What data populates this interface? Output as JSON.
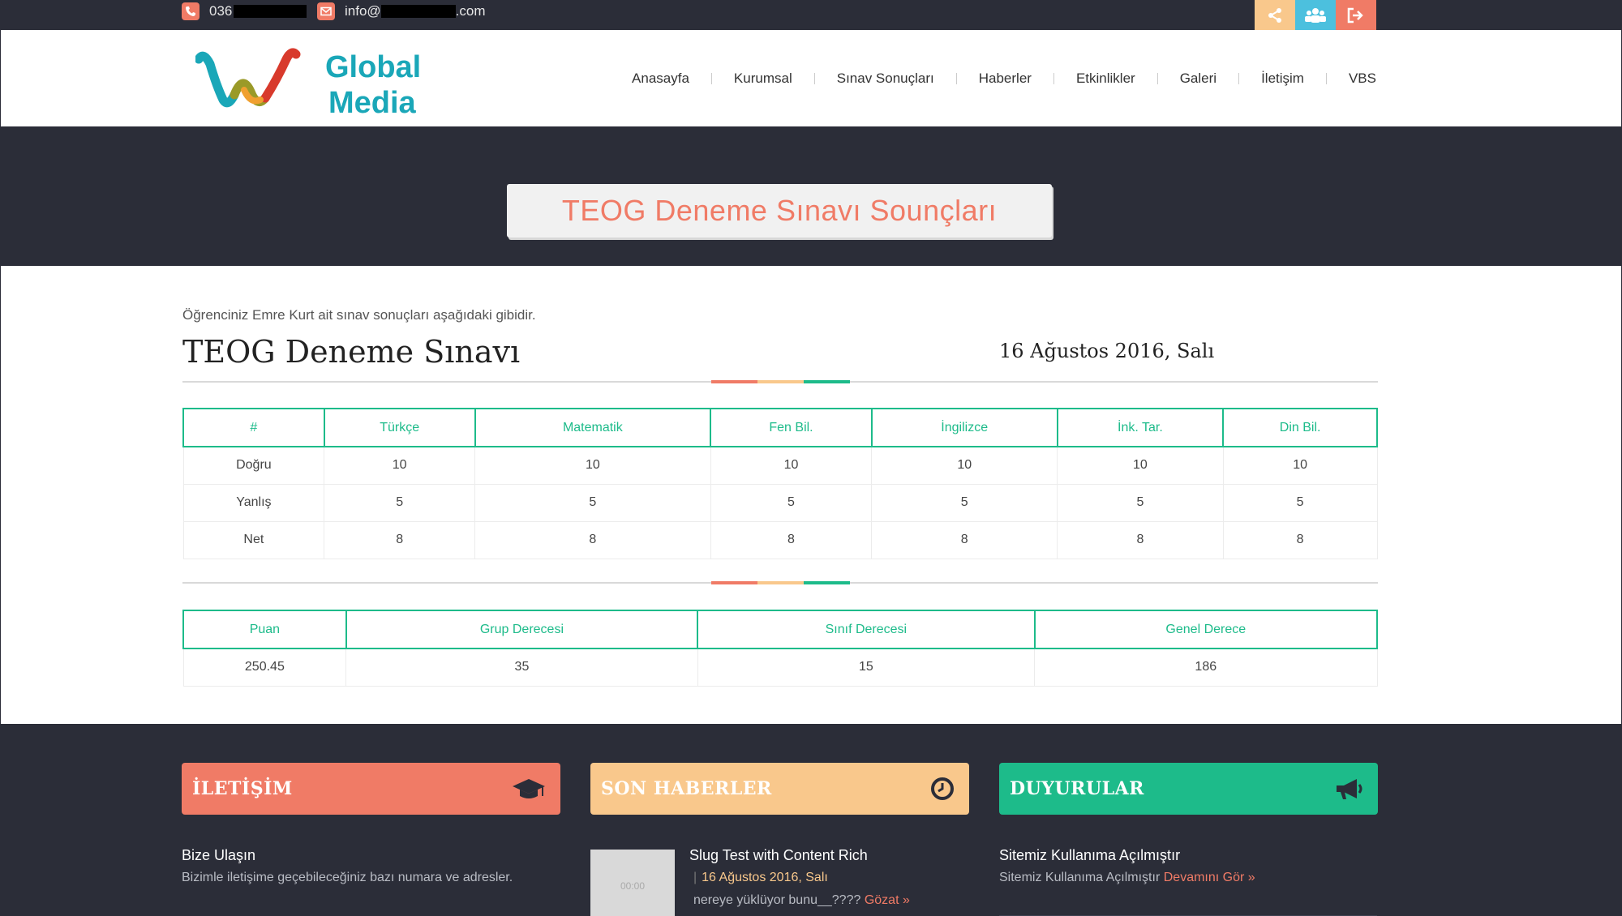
{
  "topbar": {
    "phone": "036",
    "email_prefix": "info@",
    "email_suffix": ".com",
    "colors": {
      "share": "#f9c88c",
      "users": "#4cc0de",
      "logout": "#f07b66"
    }
  },
  "header": {
    "logo_line1": "Global",
    "logo_line2": "Media",
    "nav": [
      "Anasayfa",
      "Kurumsal",
      "Sınav Sonuçları",
      "Haberler",
      "Etkinlikler",
      "Galeri",
      "İletişim",
      "VBS"
    ]
  },
  "hero": {
    "title": "TEOG Deneme Sınavı Sounçları"
  },
  "content": {
    "intro": "Öğrenciniz Emre Kurt ait sınav sonuçları aşağıdaki gibidir.",
    "exam_title": "TEOG Deneme Sınavı",
    "exam_date": "16 Ağustos 2016, Salı",
    "subjects_table": {
      "headers": [
        "#",
        "Türkçe",
        "Matematik",
        "Fen Bil.",
        "İngilizce",
        "İnk. Tar.",
        "Din Bil."
      ],
      "rows": [
        [
          "Doğru",
          "10",
          "10",
          "10",
          "10",
          "10",
          "10"
        ],
        [
          "Yanlış",
          "5",
          "5",
          "5",
          "5",
          "5",
          "5"
        ],
        [
          "Net",
          "8",
          "8",
          "8",
          "8",
          "8",
          "8"
        ]
      ]
    },
    "score_table": {
      "headers": [
        "Puan",
        "Grup Derecesi",
        "Sınıf Derecesi",
        "Genel Derece"
      ],
      "rows": [
        [
          "250.45",
          "35",
          "15",
          "186"
        ]
      ]
    }
  },
  "footer": {
    "contact": {
      "title": "İLETİŞİM",
      "subtitle": "Bize Ulaşın",
      "text": "Bizimle iletişime geçebileceğiniz bazı numara ve adresler."
    },
    "news": {
      "title": "SON HABERLER",
      "item_title": "Slug Test with Content Rich",
      "item_date": "16 Ağustos 2016, Salı",
      "item_text": "nereye yüklüyor bunu__????",
      "item_link": "Gözat »",
      "thumb_text": "00:00"
    },
    "announcements": {
      "title": "DUYURULAR",
      "item_title": "Sitemiz Kullanıma Açılmıştır",
      "item_text": "Sitemiz Kullanıma Açılmıştır",
      "item_link": "Devamını Gör »"
    },
    "colors": {
      "contact": "#f07b66",
      "news": "#f9c88c",
      "announcements": "#1dbb8a"
    }
  }
}
